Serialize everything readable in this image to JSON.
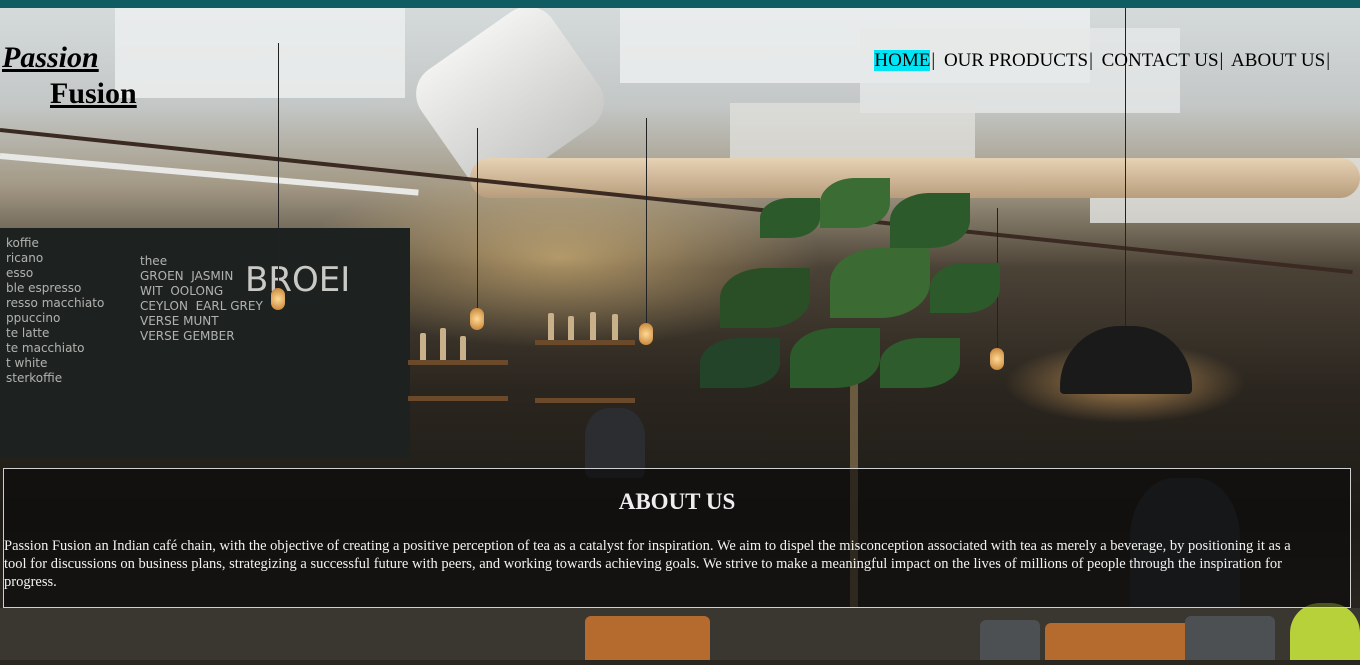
{
  "brand": {
    "line1": "Passion",
    "line2": "Fusion"
  },
  "nav": {
    "items": [
      {
        "label": "HOME",
        "active": true
      },
      {
        "label": "OUR PRODUCTS",
        "active": false
      },
      {
        "label": "CONTACT US",
        "active": false
      },
      {
        "label": "ABOUT US",
        "active": false
      }
    ],
    "separator": "|"
  },
  "about": {
    "title": "ABOUT US",
    "body": "Passion Fusion an Indian café chain, with the objective of creating a positive perception of tea as a catalyst for inspiration. We aim to dispel the misconception associated with tea as merely a beverage, by positioning it as a tool for discussions on business plans, strategizing a successful future with peers, and working towards achieving goals. We strive to make a meaningful impact on the lives of millions of people through the inspiration for progress."
  },
  "background": {
    "chalkboard_text": "koffie\nricano\nesso\nble espresso\nresso macchiato\nppuccino\nte latte\nte macchiato\nt white\nsterkoffie",
    "chalkboard_text_2": "thee\nGROEN  JASMIN\nWIT  OOLONG\nCEYLON  EARL GREY\nVERSE MUNT\nVERSE GEMBER",
    "sign_text": "BROEI"
  },
  "colors": {
    "topbar": "#0f5c63",
    "active_nav": "#00e5f5"
  }
}
